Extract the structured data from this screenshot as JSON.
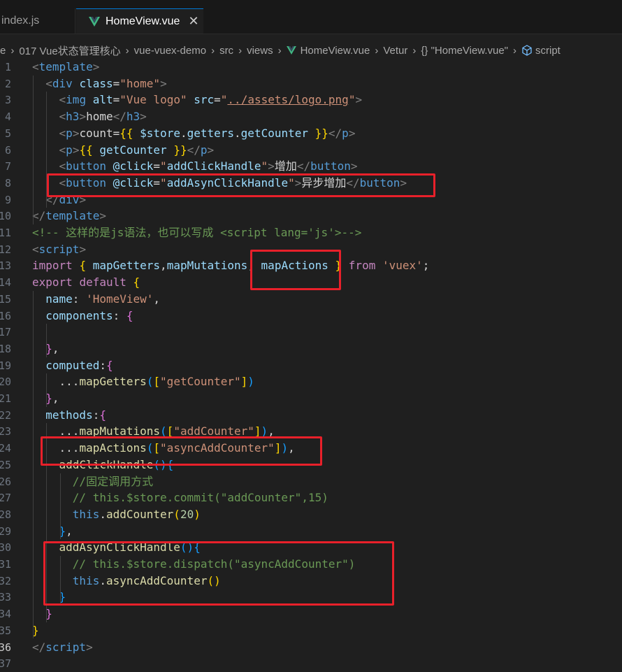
{
  "tabs": [
    {
      "label": "index.js",
      "active": false
    },
    {
      "label": "HomeView.vue",
      "active": true,
      "close": "✕"
    }
  ],
  "breadcrumb": {
    "items": [
      "e",
      "017 Vue状态管理核心",
      "vue-vuex-demo",
      "src",
      "views",
      "HomeView.vue",
      "Vetur",
      "{} \"HomeView.vue\"",
      "script"
    ],
    "separator": "›"
  },
  "current_line": 36,
  "lines": [
    {
      "n": "1",
      "segs": [
        [
          "t",
          "<"
        ],
        [
          "tag",
          "template"
        ],
        [
          "t",
          ">"
        ]
      ]
    },
    {
      "n": "2",
      "segs": [
        [
          "txt",
          "  "
        ],
        [
          "t",
          "<"
        ],
        [
          "tag",
          "div"
        ],
        [
          "txt",
          " "
        ],
        [
          "attr",
          "class"
        ],
        [
          "txt",
          "="
        ],
        [
          "str",
          "\"home\""
        ],
        [
          "t",
          ">"
        ]
      ]
    },
    {
      "n": "3",
      "segs": [
        [
          "txt",
          "    "
        ],
        [
          "t",
          "<"
        ],
        [
          "tag",
          "img"
        ],
        [
          "txt",
          " "
        ],
        [
          "attr",
          "alt"
        ],
        [
          "txt",
          "="
        ],
        [
          "str",
          "\"Vue logo\""
        ],
        [
          "txt",
          " "
        ],
        [
          "attr",
          "src"
        ],
        [
          "txt",
          "="
        ],
        [
          "str",
          "\""
        ],
        [
          "strlink",
          "../assets/logo.png"
        ],
        [
          "str",
          "\""
        ],
        [
          "t",
          ">"
        ]
      ]
    },
    {
      "n": "4",
      "segs": [
        [
          "txt",
          "    "
        ],
        [
          "t",
          "<"
        ],
        [
          "tag",
          "h3"
        ],
        [
          "t",
          ">"
        ],
        [
          "txt",
          "home"
        ],
        [
          "t",
          "</"
        ],
        [
          "tag",
          "h3"
        ],
        [
          "t",
          ">"
        ]
      ]
    },
    {
      "n": "5",
      "segs": [
        [
          "txt",
          "    "
        ],
        [
          "t",
          "<"
        ],
        [
          "tag",
          "p"
        ],
        [
          "t",
          ">"
        ],
        [
          "txt",
          "count="
        ],
        [
          "p1",
          "{{"
        ],
        [
          "txt",
          " "
        ],
        [
          "var",
          "$store"
        ],
        [
          "txt",
          "."
        ],
        [
          "var",
          "getters"
        ],
        [
          "txt",
          "."
        ],
        [
          "var",
          "getCounter"
        ],
        [
          "txt",
          " "
        ],
        [
          "p1",
          "}}"
        ],
        [
          "t",
          "</"
        ],
        [
          "tag",
          "p"
        ],
        [
          "t",
          ">"
        ]
      ]
    },
    {
      "n": "6",
      "segs": [
        [
          "txt",
          "    "
        ],
        [
          "t",
          "<"
        ],
        [
          "tag",
          "p"
        ],
        [
          "t",
          ">"
        ],
        [
          "p1",
          "{{"
        ],
        [
          "txt",
          " "
        ],
        [
          "var",
          "getCounter"
        ],
        [
          "txt",
          " "
        ],
        [
          "p1",
          "}}"
        ],
        [
          "t",
          "</"
        ],
        [
          "tag",
          "p"
        ],
        [
          "t",
          ">"
        ]
      ]
    },
    {
      "n": "7",
      "segs": [
        [
          "txt",
          "    "
        ],
        [
          "t",
          "<"
        ],
        [
          "tag",
          "button"
        ],
        [
          "txt",
          " "
        ],
        [
          "attr",
          "@click"
        ],
        [
          "txt",
          "="
        ],
        [
          "str",
          "\""
        ],
        [
          "var",
          "addClickHandle"
        ],
        [
          "str",
          "\""
        ],
        [
          "t",
          ">"
        ],
        [
          "txt",
          "增加"
        ],
        [
          "t",
          "</"
        ],
        [
          "tag",
          "button"
        ],
        [
          "t",
          ">"
        ]
      ]
    },
    {
      "n": "8",
      "segs": [
        [
          "txt",
          "    "
        ],
        [
          "t",
          "<"
        ],
        [
          "tag",
          "button"
        ],
        [
          "txt",
          " "
        ],
        [
          "attr",
          "@click"
        ],
        [
          "txt",
          "="
        ],
        [
          "str",
          "\""
        ],
        [
          "var",
          "addAsynClickHandle"
        ],
        [
          "str",
          "\""
        ],
        [
          "t",
          ">"
        ],
        [
          "txt",
          "异步增加"
        ],
        [
          "t",
          "</"
        ],
        [
          "tag",
          "button"
        ],
        [
          "t",
          ">"
        ]
      ]
    },
    {
      "n": "9",
      "segs": [
        [
          "txt",
          "  "
        ],
        [
          "t",
          "</"
        ],
        [
          "tag",
          "div"
        ],
        [
          "t",
          ">"
        ]
      ]
    },
    {
      "n": "10",
      "segs": [
        [
          "t",
          "</"
        ],
        [
          "tag",
          "template"
        ],
        [
          "t",
          ">"
        ]
      ]
    },
    {
      "n": "11",
      "segs": [
        [
          "cmt",
          "<!-- 这样的是js语法，也可以写成 <script lang='js'>-->"
        ]
      ]
    },
    {
      "n": "12",
      "segs": [
        [
          "t",
          "<"
        ],
        [
          "tag",
          "script"
        ],
        [
          "t",
          ">"
        ]
      ]
    },
    {
      "n": "13",
      "segs": [
        [
          "kw",
          "import"
        ],
        [
          "txt",
          " "
        ],
        [
          "p1",
          "{"
        ],
        [
          "txt",
          " "
        ],
        [
          "var",
          "mapGetters"
        ],
        [
          "txt",
          ","
        ],
        [
          "var",
          "mapMutations"
        ],
        [
          "txt",
          ", "
        ],
        [
          "var",
          "mapActions"
        ],
        [
          "txt",
          " "
        ],
        [
          "p1",
          "}"
        ],
        [
          "txt",
          " "
        ],
        [
          "kw",
          "from"
        ],
        [
          "txt",
          " "
        ],
        [
          "str",
          "'vuex'"
        ],
        [
          "txt",
          ";"
        ]
      ]
    },
    {
      "n": "14",
      "segs": [
        [
          "kw",
          "export"
        ],
        [
          "txt",
          " "
        ],
        [
          "kw",
          "default"
        ],
        [
          "txt",
          " "
        ],
        [
          "p1",
          "{"
        ]
      ]
    },
    {
      "n": "15",
      "segs": [
        [
          "txt",
          "  "
        ],
        [
          "var",
          "name"
        ],
        [
          "txt",
          ": "
        ],
        [
          "str",
          "'HomeView'"
        ],
        [
          "txt",
          ","
        ]
      ]
    },
    {
      "n": "16",
      "segs": [
        [
          "txt",
          "  "
        ],
        [
          "var",
          "components"
        ],
        [
          "txt",
          ": "
        ],
        [
          "p2",
          "{"
        ]
      ]
    },
    {
      "n": "17",
      "segs": []
    },
    {
      "n": "18",
      "segs": [
        [
          "txt",
          "  "
        ],
        [
          "p2",
          "}"
        ],
        [
          "txt",
          ","
        ]
      ]
    },
    {
      "n": "19",
      "segs": [
        [
          "txt",
          "  "
        ],
        [
          "var",
          "computed"
        ],
        [
          "txt",
          ":"
        ],
        [
          "p2",
          "{"
        ]
      ]
    },
    {
      "n": "20",
      "segs": [
        [
          "txt",
          "    ..."
        ],
        [
          "fn",
          "mapGetters"
        ],
        [
          "p3",
          "("
        ],
        [
          "p1",
          "["
        ],
        [
          "str",
          "\"getCounter\""
        ],
        [
          "p1",
          "]"
        ],
        [
          "p3",
          ")"
        ]
      ]
    },
    {
      "n": "21",
      "segs": [
        [
          "txt",
          "  "
        ],
        [
          "p2",
          "}"
        ],
        [
          "txt",
          ","
        ]
      ]
    },
    {
      "n": "22",
      "segs": [
        [
          "txt",
          "  "
        ],
        [
          "var",
          "methods"
        ],
        [
          "txt",
          ":"
        ],
        [
          "p2",
          "{"
        ]
      ]
    },
    {
      "n": "23",
      "segs": [
        [
          "txt",
          "    ..."
        ],
        [
          "fn",
          "mapMutations"
        ],
        [
          "p3",
          "("
        ],
        [
          "p1",
          "["
        ],
        [
          "str",
          "\"addCounter\""
        ],
        [
          "p1",
          "]"
        ],
        [
          "p3",
          ")"
        ],
        [
          "txt",
          ","
        ]
      ]
    },
    {
      "n": "24",
      "segs": [
        [
          "txt",
          "    ..."
        ],
        [
          "fn",
          "mapActions"
        ],
        [
          "p3",
          "("
        ],
        [
          "p1",
          "["
        ],
        [
          "str",
          "\"asyncAddCounter\""
        ],
        [
          "p1",
          "]"
        ],
        [
          "p3",
          ")"
        ],
        [
          "txt",
          ","
        ]
      ]
    },
    {
      "n": "25",
      "segs": [
        [
          "txt",
          "    "
        ],
        [
          "fn",
          "addClickHandle"
        ],
        [
          "p3",
          "()"
        ],
        [
          "p3",
          "{"
        ]
      ]
    },
    {
      "n": "26",
      "segs": [
        [
          "txt",
          "      "
        ],
        [
          "cmt",
          "//固定调用方式"
        ]
      ]
    },
    {
      "n": "27",
      "segs": [
        [
          "txt",
          "      "
        ],
        [
          "cmt",
          "// this.$store.commit(\"addCounter\",15)"
        ]
      ]
    },
    {
      "n": "28",
      "segs": [
        [
          "txt",
          "      "
        ],
        [
          "kw2",
          "this"
        ],
        [
          "txt",
          "."
        ],
        [
          "fn",
          "addCounter"
        ],
        [
          "p1",
          "("
        ],
        [
          "num",
          "20"
        ],
        [
          "p1",
          ")"
        ]
      ]
    },
    {
      "n": "29",
      "segs": [
        [
          "txt",
          "    "
        ],
        [
          "p3",
          "}"
        ],
        [
          "txt",
          ","
        ]
      ]
    },
    {
      "n": "30",
      "segs": [
        [
          "txt",
          "    "
        ],
        [
          "fn",
          "addAsynClickHandle"
        ],
        [
          "p3",
          "()"
        ],
        [
          "p3",
          "{"
        ]
      ]
    },
    {
      "n": "31",
      "segs": [
        [
          "txt",
          "      "
        ],
        [
          "cmt",
          "// this.$store.dispatch(\"asyncAddCounter\")"
        ]
      ]
    },
    {
      "n": "32",
      "segs": [
        [
          "txt",
          "      "
        ],
        [
          "kw2",
          "this"
        ],
        [
          "txt",
          "."
        ],
        [
          "fn",
          "asyncAddCounter"
        ],
        [
          "p1",
          "()"
        ]
      ]
    },
    {
      "n": "33",
      "segs": [
        [
          "txt",
          "    "
        ],
        [
          "p3",
          "}"
        ]
      ]
    },
    {
      "n": "34",
      "segs": [
        [
          "txt",
          "  "
        ],
        [
          "p2",
          "}"
        ]
      ]
    },
    {
      "n": "35",
      "segs": [
        [
          "p1",
          "}"
        ]
      ]
    },
    {
      "n": "36",
      "segs": [
        [
          "t",
          "</"
        ],
        [
          "tag",
          "script"
        ],
        [
          "t",
          ">"
        ]
      ]
    },
    {
      "n": "37",
      "segs": []
    }
  ],
  "colors": {
    "background": "#1f1f1f",
    "highlight_box": "#e8202a",
    "vue_green": "#41b883"
  }
}
